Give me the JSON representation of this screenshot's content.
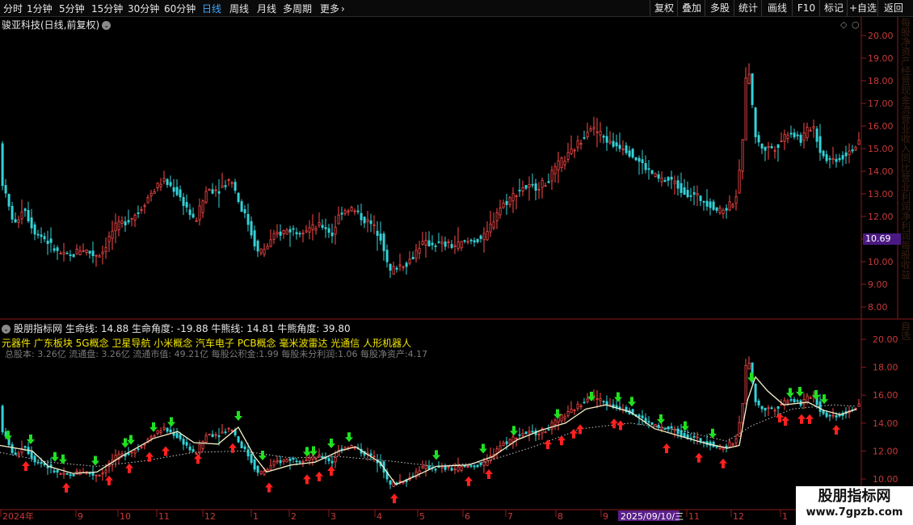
{
  "toolbar": {
    "timeframes": [
      "分时",
      "1分钟",
      "5分钟",
      "15分钟",
      "30分钟",
      "60分钟",
      "日线",
      "周线",
      "月线",
      "多周期",
      "更多"
    ],
    "active_timeframe": "日线",
    "more_chevron": "›",
    "right_buttons": [
      "复权",
      "叠加",
      "多股",
      "统计",
      "画线",
      "F10",
      "标记",
      "+自选",
      "返回"
    ]
  },
  "stock": {
    "title": "骏亚科技(日线,前复权)",
    "price_axis": [
      "20.00",
      "19.00",
      "18.00",
      "17.00",
      "16.00",
      "15.00",
      "14.00",
      "13.00",
      "12.00",
      "11.00",
      "10.00",
      "9.00",
      "8.00"
    ],
    "current_price_label": "10.69",
    "side_strip_text": "每股净资产经营现金流营业收入同比营业利润净利润每股收益"
  },
  "indicator": {
    "name": "股朋指标网",
    "stats": "生命线: 14.88  生命角度: -19.88  牛熊线: 14.81  牛熊角度: 39.80",
    "concepts": "元器件 广东板块 5G概念 卫星导航 小米概念 汽车电子 PCB概念 毫米波雷达 光通信 人形机器人",
    "fundamentals": "总股本: 3.26亿 流通盘: 3.26亿 流通市值: 49.21亿 每股公积金:1.99 每股未分利润:1.06 每股净资产:4.17",
    "price_axis": [
      "20.00",
      "18.00",
      "16.00",
      "14.00",
      "12.00",
      "10.00"
    ],
    "side_strip_text": "自选"
  },
  "time_axis": {
    "labels": [
      "2024年",
      "9",
      "10",
      "11",
      "12",
      "1",
      "2",
      "3",
      "4",
      "5",
      "6",
      "7",
      "8",
      "9",
      "10",
      "11",
      "12",
      "1"
    ],
    "cursor_date": "2025/09/10/三"
  },
  "watermark": {
    "line1": "股朋指标网",
    "line2": "www.7gpzb.com"
  },
  "colors": {
    "up": "#ff4a4a",
    "down": "#34d3d8",
    "buy_arrow": "#ff2020",
    "sell_arrow": "#20e020",
    "life_line": "#f5f0c8",
    "bull_bear_line": "#c8c8c8",
    "cursor_bg": "#5a1f8a"
  },
  "chart_data": {
    "type": "candlestick",
    "title": "骏亚科技(日线,前复权)",
    "ylim": [
      7.6,
      20.6
    ],
    "price_points": [
      [
        0,
        13.8
      ],
      [
        8,
        12.6
      ],
      [
        18,
        11.6
      ],
      [
        28,
        12.5
      ],
      [
        40,
        11.4
      ],
      [
        55,
        11.0
      ],
      [
        70,
        10.4
      ],
      [
        85,
        10.2
      ],
      [
        100,
        10.6
      ],
      [
        115,
        10.3
      ],
      [
        125,
        10.4
      ],
      [
        140,
        11.5
      ],
      [
        155,
        11.8
      ],
      [
        170,
        12.2
      ],
      [
        185,
        13.0
      ],
      [
        200,
        13.6
      ],
      [
        215,
        13.2
      ],
      [
        230,
        12.4
      ],
      [
        240,
        11.7
      ],
      [
        255,
        13.2
      ],
      [
        270,
        13.2
      ],
      [
        285,
        13.7
      ],
      [
        295,
        12.6
      ],
      [
        305,
        11.8
      ],
      [
        318,
        10.4
      ],
      [
        328,
        10.6
      ],
      [
        340,
        11.2
      ],
      [
        355,
        11.4
      ],
      [
        370,
        11.4
      ],
      [
        385,
        11.5
      ],
      [
        400,
        11.6
      ],
      [
        410,
        11.2
      ],
      [
        420,
        12.2
      ],
      [
        432,
        12.4
      ],
      [
        445,
        12.0
      ],
      [
        460,
        11.6
      ],
      [
        472,
        11.0
      ],
      [
        480,
        9.5
      ],
      [
        490,
        9.8
      ],
      [
        505,
        10.0
      ],
      [
        520,
        10.8
      ],
      [
        540,
        10.8
      ],
      [
        560,
        10.7
      ],
      [
        580,
        10.9
      ],
      [
        600,
        11.1
      ],
      [
        615,
        12.3
      ],
      [
        630,
        12.8
      ],
      [
        645,
        13.3
      ],
      [
        660,
        13.3
      ],
      [
        675,
        13.5
      ],
      [
        690,
        14.3
      ],
      [
        705,
        14.8
      ],
      [
        718,
        15.4
      ],
      [
        728,
        16.0
      ],
      [
        740,
        15.7
      ],
      [
        755,
        15.2
      ],
      [
        770,
        15.1
      ],
      [
        785,
        14.6
      ],
      [
        800,
        14.1
      ],
      [
        815,
        13.6
      ],
      [
        830,
        13.6
      ],
      [
        845,
        13.1
      ],
      [
        860,
        12.9
      ],
      [
        875,
        12.6
      ],
      [
        890,
        12.2
      ],
      [
        905,
        12.6
      ],
      [
        912,
        13.1
      ],
      [
        918,
        15.5
      ],
      [
        924,
        19.2
      ],
      [
        930,
        16.8
      ],
      [
        935,
        15.3
      ],
      [
        945,
        15.0
      ],
      [
        960,
        15.1
      ],
      [
        975,
        15.8
      ],
      [
        990,
        15.4
      ],
      [
        1005,
        16.1
      ],
      [
        1015,
        14.8
      ],
      [
        1025,
        14.5
      ],
      [
        1040,
        14.6
      ],
      [
        1052,
        15.0
      ],
      [
        1062,
        15.2
      ]
    ],
    "life_line_points": [
      [
        0,
        12.4
      ],
      [
        40,
        12.0
      ],
      [
        60,
        10.9
      ],
      [
        90,
        10.4
      ],
      [
        120,
        10.5
      ],
      [
        150,
        11.6
      ],
      [
        190,
        12.9
      ],
      [
        220,
        13.4
      ],
      [
        240,
        12.6
      ],
      [
        270,
        12.5
      ],
      [
        295,
        13.7
      ],
      [
        315,
        11.6
      ],
      [
        330,
        10.5
      ],
      [
        360,
        11.0
      ],
      [
        390,
        11.2
      ],
      [
        420,
        12.0
      ],
      [
        440,
        12.3
      ],
      [
        470,
        11.2
      ],
      [
        490,
        9.6
      ],
      [
        510,
        10.1
      ],
      [
        540,
        10.9
      ],
      [
        580,
        11.0
      ],
      [
        610,
        11.6
      ],
      [
        640,
        12.8
      ],
      [
        670,
        13.5
      ],
      [
        700,
        14.0
      ],
      [
        725,
        15.0
      ],
      [
        750,
        15.3
      ],
      [
        780,
        14.8
      ],
      [
        810,
        13.6
      ],
      [
        840,
        13.1
      ],
      [
        870,
        12.6
      ],
      [
        900,
        12.2
      ],
      [
        915,
        12.4
      ],
      [
        925,
        15.6
      ],
      [
        935,
        17.3
      ],
      [
        950,
        16.3
      ],
      [
        970,
        15.3
      ],
      [
        1000,
        15.5
      ],
      [
        1020,
        14.9
      ],
      [
        1040,
        14.6
      ],
      [
        1060,
        15.0
      ]
    ],
    "bull_bear_points": [
      [
        0,
        11.9
      ],
      [
        60,
        11.2
      ],
      [
        120,
        10.9
      ],
      [
        180,
        11.3
      ],
      [
        240,
        11.9
      ],
      [
        300,
        12.0
      ],
      [
        360,
        11.5
      ],
      [
        420,
        11.6
      ],
      [
        480,
        11.3
      ],
      [
        540,
        10.9
      ],
      [
        600,
        11.2
      ],
      [
        660,
        12.3
      ],
      [
        720,
        13.6
      ],
      [
        780,
        14.0
      ],
      [
        840,
        13.5
      ],
      [
        900,
        12.7
      ],
      [
        930,
        13.8
      ],
      [
        980,
        15.0
      ],
      [
        1030,
        15.3
      ],
      [
        1060,
        15.2
      ]
    ],
    "buy_signal_x": [
      32,
      82,
      135,
      160,
      185,
      205,
      245,
      288,
      333,
      380,
      395,
      410,
      488,
      580,
      605,
      678,
      695,
      710,
      718,
      760,
      768,
      825,
      865,
      895,
      965,
      972,
      992,
      1002,
      1035
    ],
    "sell_signal_x": [
      10,
      38,
      68,
      78,
      118,
      155,
      162,
      190,
      212,
      295,
      325,
      380,
      388,
      410,
      432,
      540,
      598,
      636,
      690,
      732,
      765,
      782,
      818,
      848,
      882,
      930,
      978,
      990,
      1010,
      1020
    ]
  }
}
